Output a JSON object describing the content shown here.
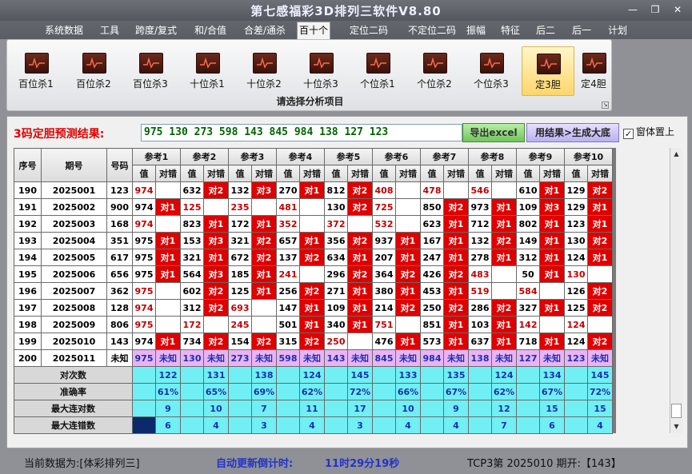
{
  "app": {
    "title": "第七感福彩3D排列三软件V8.80"
  },
  "window": {
    "minimize": "—",
    "restore": "❐",
    "close": "✕"
  },
  "menu": [
    "系统数据",
    "工具",
    "跨度/复式",
    "和/合值",
    "合差/通杀",
    "百十个",
    "定位二码",
    "不定位二码",
    "振幅",
    "特征",
    "后二",
    "后一",
    "计划"
  ],
  "menu_active": "百十个",
  "ribbon": {
    "buttons": [
      "百位杀1",
      "百位杀2",
      "百位杀3",
      "十位杀1",
      "十位杀2",
      "十位杀3",
      "个位杀1",
      "个位杀2",
      "个位杀3",
      "定3胆",
      "定4胆"
    ],
    "selected": "定3胆",
    "group_label": "请选择分析项目"
  },
  "prediction": {
    "label": "3码定胆预测结果:",
    "value": "975 130 273 598 143 845 984 138 127 123",
    "export_button": "导出excel",
    "generate_button": "用结果>生成大底",
    "ontop_label": "窗体置上",
    "ontop_checked": "✓"
  },
  "table": {
    "headers": {
      "idx": "序号",
      "period": "期号",
      "num": "号码",
      "val": "值",
      "judge": "对错"
    },
    "refs": [
      "参考1",
      "参考2",
      "参考3",
      "参考4",
      "参考5",
      "参考6",
      "参考7",
      "参考8",
      "参考9",
      "参考10"
    ],
    "rows": [
      {
        "idx": "190",
        "period": "2025001",
        "num": "123",
        "cells": [
          [
            "974",
            "",
            "r"
          ],
          [
            "632",
            "对2",
            ""
          ],
          [
            "132",
            "对3",
            ""
          ],
          [
            "270",
            "对1",
            ""
          ],
          [
            "812",
            "对2",
            ""
          ],
          [
            "408",
            "",
            "r"
          ],
          [
            "478",
            "",
            "r"
          ],
          [
            "546",
            "",
            "r"
          ],
          [
            "610",
            "对1",
            ""
          ],
          [
            "129",
            "对2",
            ""
          ]
        ]
      },
      {
        "idx": "191",
        "period": "2025002",
        "num": "900",
        "cells": [
          [
            "974",
            "对1",
            ""
          ],
          [
            "125",
            "",
            "r"
          ],
          [
            "235",
            "",
            "r"
          ],
          [
            "481",
            "",
            "r"
          ],
          [
            "130",
            "对2",
            ""
          ],
          [
            "725",
            "",
            "r"
          ],
          [
            "850",
            "对2",
            ""
          ],
          [
            "973",
            "对1",
            ""
          ],
          [
            "109",
            "对3",
            ""
          ],
          [
            "129",
            "对1",
            ""
          ]
        ]
      },
      {
        "idx": "192",
        "period": "2025003",
        "num": "168",
        "cells": [
          [
            "974",
            "",
            "r"
          ],
          [
            "823",
            "对1",
            ""
          ],
          [
            "172",
            "对1",
            ""
          ],
          [
            "352",
            "",
            "r"
          ],
          [
            "372",
            "",
            "r"
          ],
          [
            "532",
            "",
            "r"
          ],
          [
            "623",
            "对1",
            ""
          ],
          [
            "712",
            "对1",
            ""
          ],
          [
            "802",
            "对1",
            ""
          ],
          [
            "123",
            "对1",
            ""
          ]
        ]
      },
      {
        "idx": "193",
        "period": "2025004",
        "num": "351",
        "cells": [
          [
            "975",
            "对1",
            ""
          ],
          [
            "153",
            "对3",
            ""
          ],
          [
            "321",
            "对2",
            ""
          ],
          [
            "657",
            "对1",
            ""
          ],
          [
            "356",
            "对2",
            ""
          ],
          [
            "937",
            "对1",
            ""
          ],
          [
            "167",
            "对1",
            ""
          ],
          [
            "132",
            "对2",
            ""
          ],
          [
            "149",
            "对1",
            ""
          ],
          [
            "130",
            "对2",
            ""
          ]
        ]
      },
      {
        "idx": "194",
        "period": "2025005",
        "num": "617",
        "cells": [
          [
            "975",
            "对1",
            ""
          ],
          [
            "321",
            "对1",
            ""
          ],
          [
            "672",
            "对2",
            ""
          ],
          [
            "137",
            "对2",
            ""
          ],
          [
            "634",
            "对1",
            ""
          ],
          [
            "207",
            "对1",
            ""
          ],
          [
            "247",
            "对1",
            ""
          ],
          [
            "278",
            "对1",
            ""
          ],
          [
            "312",
            "对1",
            ""
          ],
          [
            "124",
            "对1",
            ""
          ]
        ]
      },
      {
        "idx": "195",
        "period": "2025006",
        "num": "656",
        "cells": [
          [
            "975",
            "对1",
            ""
          ],
          [
            "564",
            "对3",
            ""
          ],
          [
            "185",
            "对1",
            ""
          ],
          [
            "241",
            "",
            "r"
          ],
          [
            "296",
            "对2",
            ""
          ],
          [
            "364",
            "对2",
            ""
          ],
          [
            "426",
            "对2",
            ""
          ],
          [
            "483",
            "",
            "r"
          ],
          [
            "50",
            "对1",
            ""
          ],
          [
            "130",
            "",
            "r"
          ]
        ]
      },
      {
        "idx": "196",
        "period": "2025007",
        "num": "362",
        "cells": [
          [
            "975",
            "",
            "r"
          ],
          [
            "602",
            "对2",
            ""
          ],
          [
            "125",
            "对1",
            ""
          ],
          [
            "256",
            "对2",
            ""
          ],
          [
            "271",
            "对1",
            ""
          ],
          [
            "380",
            "对1",
            ""
          ],
          [
            "453",
            "对1",
            ""
          ],
          [
            "519",
            "",
            "r"
          ],
          [
            "584",
            "",
            "r"
          ],
          [
            "126",
            "对2",
            ""
          ]
        ]
      },
      {
        "idx": "197",
        "period": "2025008",
        "num": "128",
        "cells": [
          [
            "974",
            "",
            "r"
          ],
          [
            "312",
            "对2",
            ""
          ],
          [
            "693",
            "",
            "r"
          ],
          [
            "147",
            "对1",
            ""
          ],
          [
            "109",
            "对1",
            ""
          ],
          [
            "214",
            "对2",
            ""
          ],
          [
            "250",
            "对2",
            ""
          ],
          [
            "286",
            "对2",
            ""
          ],
          [
            "327",
            "对1",
            ""
          ],
          [
            "125",
            "对2",
            ""
          ]
        ]
      },
      {
        "idx": "198",
        "period": "2025009",
        "num": "806",
        "cells": [
          [
            "975",
            "",
            "r"
          ],
          [
            "172",
            "",
            "r"
          ],
          [
            "245",
            "",
            "r"
          ],
          [
            "501",
            "对1",
            ""
          ],
          [
            "340",
            "对1",
            ""
          ],
          [
            "751",
            "",
            "r"
          ],
          [
            "851",
            "对1",
            ""
          ],
          [
            "103",
            "对1",
            ""
          ],
          [
            "142",
            "",
            "r"
          ],
          [
            "124",
            "",
            "r"
          ]
        ]
      },
      {
        "idx": "199",
        "period": "2025010",
        "num": "143",
        "cells": [
          [
            "974",
            "对1",
            ""
          ],
          [
            "734",
            "对2",
            ""
          ],
          [
            "154",
            "对2",
            ""
          ],
          [
            "315",
            "对2",
            ""
          ],
          [
            "250",
            "",
            "r"
          ],
          [
            "476",
            "对1",
            ""
          ],
          [
            "573",
            "对1",
            ""
          ],
          [
            "637",
            "对1",
            ""
          ],
          [
            "718",
            "对1",
            ""
          ],
          [
            "124",
            "对2",
            ""
          ]
        ]
      }
    ],
    "pred_row": {
      "idx": "200",
      "period": "2025011",
      "num": "未知",
      "cells": [
        [
          "975",
          "未知"
        ],
        [
          "130",
          "未知"
        ],
        [
          "273",
          "未知"
        ],
        [
          "598",
          "未知"
        ],
        [
          "143",
          "未知"
        ],
        [
          "845",
          "未知"
        ],
        [
          "984",
          "未知"
        ],
        [
          "138",
          "未知"
        ],
        [
          "127",
          "未知"
        ],
        [
          "123",
          "未知"
        ]
      ]
    },
    "stats": [
      {
        "label": "对次数",
        "values": [
          "122",
          "131",
          "138",
          "124",
          "145",
          "133",
          "135",
          "124",
          "134",
          "145"
        ]
      },
      {
        "label": "准确率",
        "values": [
          "61%",
          "65%",
          "69%",
          "62%",
          "72%",
          "66%",
          "67%",
          "62%",
          "67%",
          "72%"
        ]
      },
      {
        "label": "最大连对数",
        "values": [
          "9",
          "10",
          "7",
          "11",
          "17",
          "10",
          "9",
          "12",
          "15",
          "15"
        ]
      },
      {
        "label": "最大连错数",
        "values": [
          "6",
          "4",
          "3",
          "4",
          "3",
          "4",
          "4",
          "7",
          "6",
          "4"
        ]
      }
    ]
  },
  "status": {
    "current_data": "当前数据为:[体彩排列三]",
    "countdown_label": "自动更新倒计时:",
    "countdown_value": "11时29分19秒",
    "draw_info": "TCP3第 2025010 期开:【143】"
  }
}
